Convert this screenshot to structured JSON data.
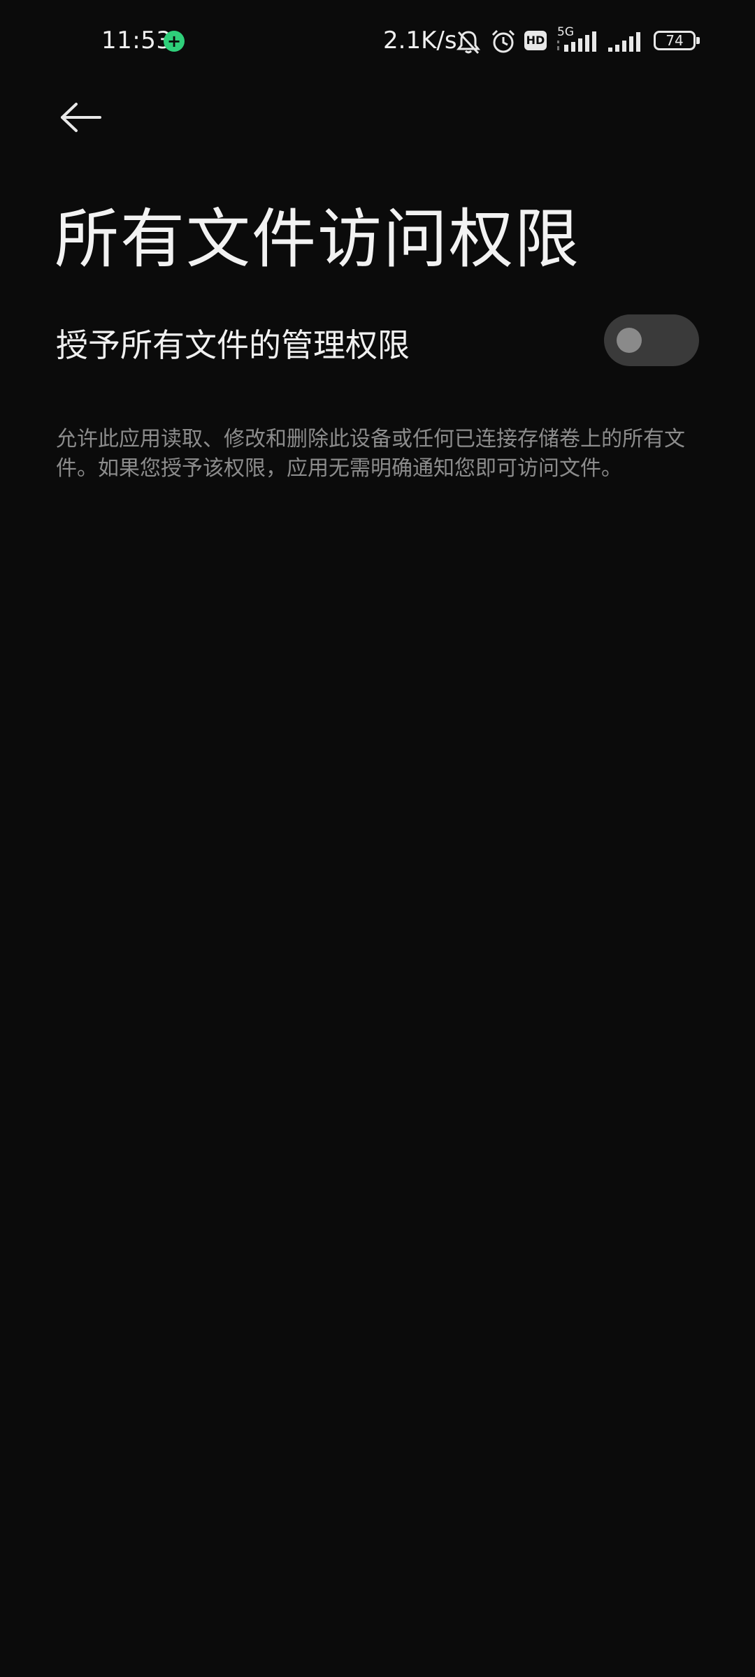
{
  "status_bar": {
    "time": "11:53",
    "net_speed": "2.1K/s",
    "network_type": "5G",
    "hd_label": "HD",
    "battery_level": "74",
    "icons": [
      "shield-plus-icon",
      "bell-off-icon",
      "alarm-icon",
      "hd-icon",
      "signal-icon",
      "signal-icon",
      "battery-icon"
    ],
    "accent_color": "#2fcf7a"
  },
  "header": {
    "back_icon": "arrow-left-icon",
    "title": "所有文件访问权限"
  },
  "setting": {
    "label": "授予所有文件的管理权限",
    "enabled": false
  },
  "description": "允许此应用读取、修改和删除此设备或任何已连接存储卷上的所有文件。如果您授予该权限，应用无需明确通知您即可访问文件。",
  "colors": {
    "background": "#0b0b0b",
    "toggle_track": "#3a3a3a",
    "toggle_knob": "#8a8a8a",
    "secondary_text": "#8c8c8c"
  }
}
